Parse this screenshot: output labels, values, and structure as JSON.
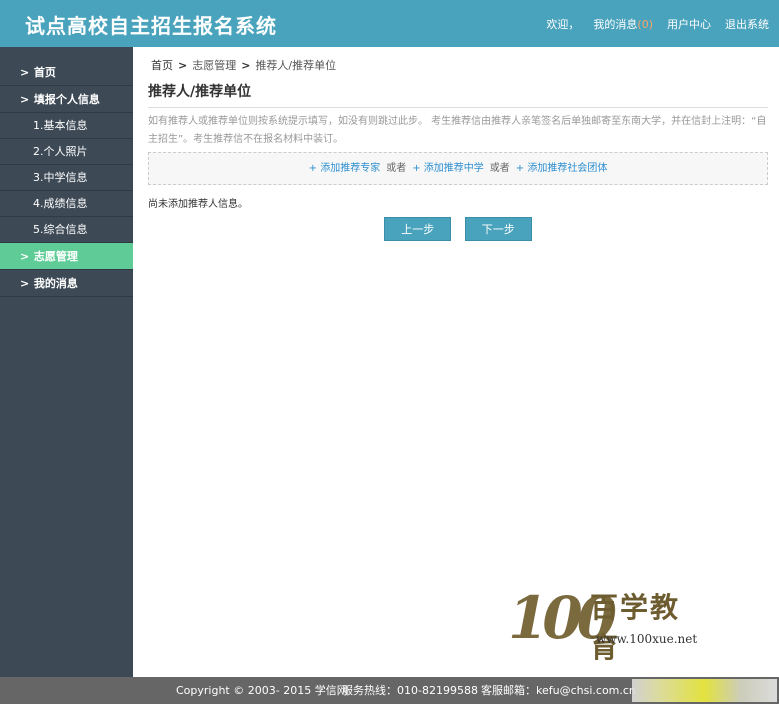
{
  "header": {
    "title": "试点高校自主招生报名系统",
    "welcome": "欢迎，",
    "messages_label": "我的消息",
    "messages_count": "(0)",
    "user_center": "用户中心",
    "logout": "退出系统"
  },
  "sidebar": {
    "items": [
      {
        "label": "首页",
        "chevron": ">"
      },
      {
        "label": "填报个人信息",
        "chevron": ">"
      },
      {
        "label": "1.基本信息"
      },
      {
        "label": "2.个人照片"
      },
      {
        "label": "3.中学信息"
      },
      {
        "label": "4.成绩信息"
      },
      {
        "label": "5.综合信息"
      },
      {
        "label": "志愿管理",
        "chevron": ">"
      },
      {
        "label": "我的消息",
        "chevron": ">"
      }
    ]
  },
  "breadcrumb": {
    "home": "首页",
    "level1": "志愿管理",
    "level2": "推荐人/推荐单位",
    "sep": ">"
  },
  "page": {
    "title": "推荐人/推荐单位",
    "description": "如有推荐人或推荐单位则按系统提示填写，如没有则跳过此步。 考生推荐信由推荐人亲笔签名后单独邮寄至东南大学，并在信封上注明：“自主招生”。考生推荐信不在报名材料中装订。",
    "add_expert": "+ 添加推荐专家",
    "or1": "或者",
    "add_school": "+ 添加推荐中学",
    "or2": "或者",
    "add_org": "+ 添加推荐社会团体",
    "empty_notice": "尚未添加推荐人信息。",
    "prev_button": "上一步",
    "next_button": "下一步"
  },
  "footer": {
    "copyright": "Copyright © 2003- 2015 学信网",
    "hotline": "服务热线：010-82199588",
    "email": "客服邮箱：kefu@chsi.com.cn"
  },
  "watermark": {
    "number": "100",
    "text": "百学教育",
    "url": "www.100xue.net"
  },
  "colors": {
    "header_bg": "#4aa3bd",
    "sidebar_bg": "#3d4a56",
    "active_item": "#5fcc97",
    "link": "#2d8fd0",
    "footer_bg": "#666666"
  }
}
